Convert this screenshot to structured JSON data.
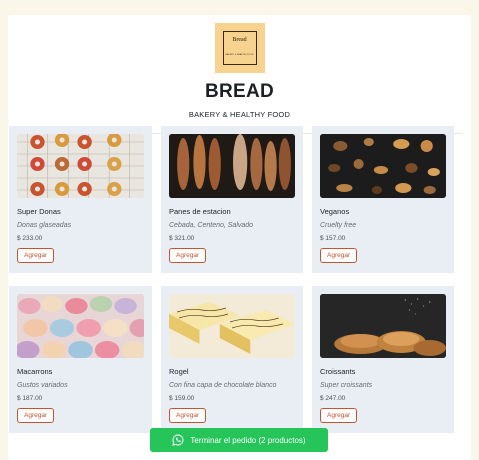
{
  "header": {
    "logo_name": "Bread",
    "logo_tagline": "BAKERY & HEALTHY FOOD",
    "brand": "BREAD",
    "tagline": "BAKERY & HEALTHY FOOD"
  },
  "products": [
    {
      "name": "Super Donas",
      "desc": "Donas glaseadas",
      "price": "$ 233.00",
      "button": "Agregar",
      "image": "donuts-image"
    },
    {
      "name": "Panes de estacion",
      "desc": "Cebada, Centeno, Salvado",
      "price": "$ 321.00",
      "button": "Agregar",
      "image": "bread-loaves-image"
    },
    {
      "name": "Veganos",
      "desc": "Cruelty free",
      "price": "$ 157.00",
      "button": "Agregar",
      "image": "vegan-pastries-image"
    },
    {
      "name": "Macarrons",
      "desc": "Gustos variados",
      "price": "$ 187.00",
      "button": "Agregar",
      "image": "macarons-image"
    },
    {
      "name": "Rogel",
      "desc": "Con fina capa de chocolate blanco",
      "price": "$ 159.00",
      "button": "Agregar",
      "image": "rogel-cake-image"
    },
    {
      "name": "Croissants",
      "desc": "Super croissants",
      "price": "$ 247.00",
      "button": "Agregar",
      "image": "croissants-image"
    }
  ],
  "order_button": {
    "label": "Terminar el pedido (2 productos)",
    "icon": "whatsapp-icon",
    "color": "#25c55a"
  },
  "colors": {
    "background": "#fbf6ea",
    "card": "#e9eef4",
    "accent": "#c0552f",
    "logo": "#f8d38f"
  }
}
